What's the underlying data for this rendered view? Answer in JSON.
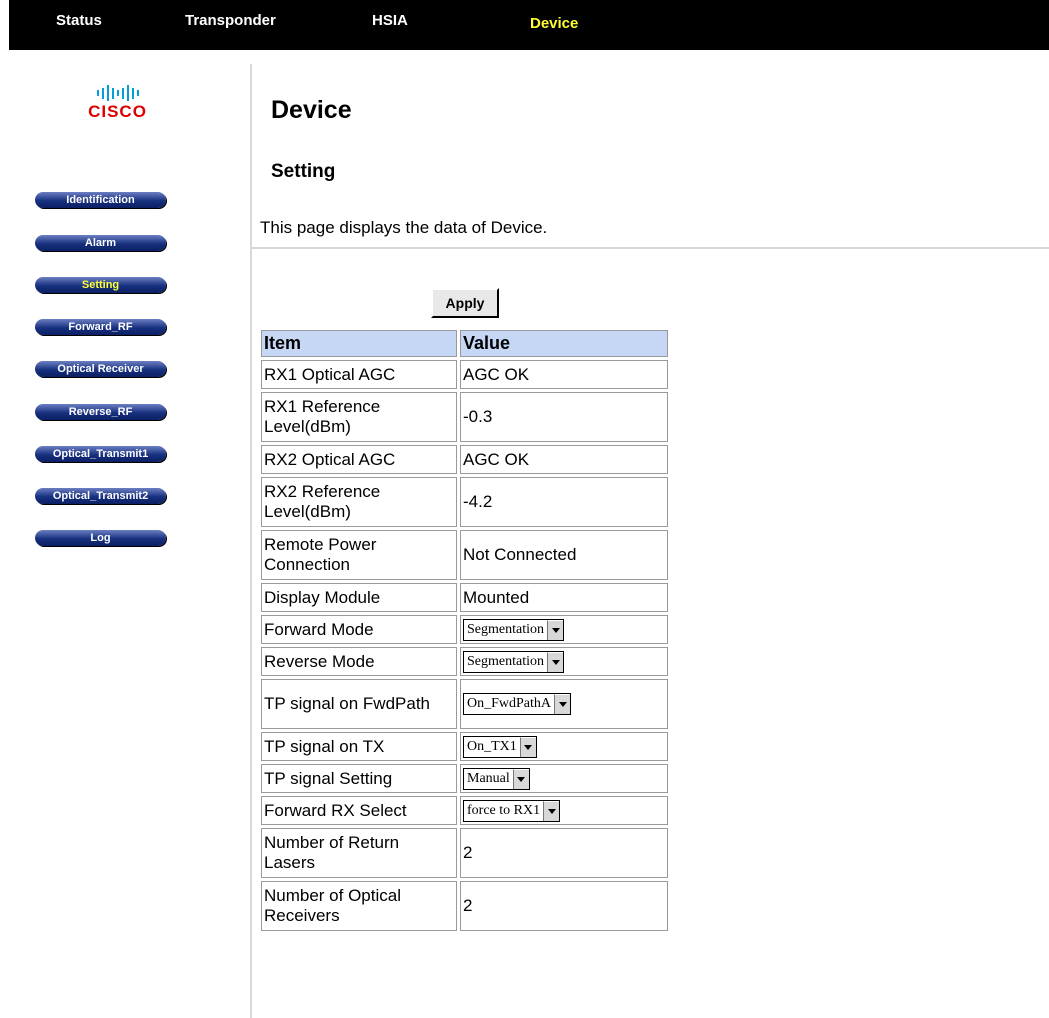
{
  "topnav": {
    "items": [
      {
        "label": "Status",
        "active": false
      },
      {
        "label": "Transponder",
        "active": false
      },
      {
        "label": "HSIA",
        "active": false
      },
      {
        "label": "Device",
        "active": true
      }
    ]
  },
  "logo": {
    "text": "cisco"
  },
  "sidebar": {
    "items": [
      {
        "label": "Identification",
        "active": false
      },
      {
        "label": "Alarm",
        "active": false
      },
      {
        "label": "Setting",
        "active": true
      },
      {
        "label": "Forward_RF",
        "active": false
      },
      {
        "label": "Optical Receiver",
        "active": false
      },
      {
        "label": "Reverse_RF",
        "active": false
      },
      {
        "label": "Optical_Transmit1",
        "active": false
      },
      {
        "label": "Optical_Transmit2",
        "active": false
      },
      {
        "label": "Log",
        "active": false
      }
    ]
  },
  "main": {
    "title": "Device",
    "section": "Setting",
    "description": "This page displays the data of Device.",
    "apply_label": "Apply",
    "table": {
      "headers": {
        "item": "Item",
        "value": "Value"
      },
      "rows": [
        {
          "item": "RX1 Optical AGC",
          "value": "AGC OK",
          "kind": "text"
        },
        {
          "item": "RX1 Reference Level(dBm)",
          "value": "-0.3",
          "kind": "text"
        },
        {
          "item": "RX2 Optical AGC",
          "value": "AGC OK",
          "kind": "text"
        },
        {
          "item": "RX2 Reference Level(dBm)",
          "value": "-4.2",
          "kind": "text"
        },
        {
          "item": "Remote Power Connection",
          "value": "Not Connected",
          "kind": "text"
        },
        {
          "item": "Display Module",
          "value": "Mounted",
          "kind": "text"
        },
        {
          "item": "Forward Mode",
          "value": "Segmentation",
          "kind": "select"
        },
        {
          "item": "Reverse Mode",
          "value": "Segmentation",
          "kind": "select"
        },
        {
          "item": "TP signal on FwdPath",
          "value": "On_FwdPathA",
          "kind": "select"
        },
        {
          "item": "TP signal on TX",
          "value": "On_TX1",
          "kind": "select"
        },
        {
          "item": "TP signal Setting",
          "value": "Manual",
          "kind": "select"
        },
        {
          "item": "Forward RX Select",
          "value": "force to RX1",
          "kind": "select"
        },
        {
          "item": "Number of Return Lasers",
          "value": "2",
          "kind": "text"
        },
        {
          "item": "Number of Optical Receivers",
          "value": "2",
          "kind": "text"
        }
      ]
    }
  }
}
